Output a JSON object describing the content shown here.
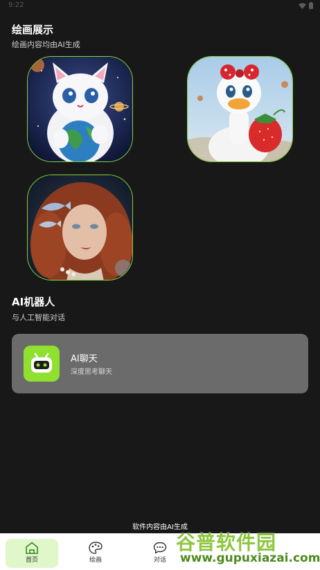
{
  "status": {
    "time": "9:22"
  },
  "gallery": {
    "title": "绘画展示",
    "subtitle": "绘画内容均由AI生成",
    "images": [
      {
        "name": "cat-holding-earth-image"
      },
      {
        "name": "duck-with-strawberry-image"
      },
      {
        "name": "redhead-woman-with-fish-image"
      }
    ]
  },
  "robot": {
    "title": "AI机器人",
    "subtitle": "与人工智能对话",
    "card": {
      "title": "AI聊天",
      "subtitle": "深度思考聊天",
      "icon": "robot-icon"
    }
  },
  "footer_note": "软件内容由AI生成",
  "tabs": [
    {
      "label": "首页",
      "icon": "home-icon",
      "active": true
    },
    {
      "label": "绘画",
      "icon": "palette-icon",
      "active": false
    },
    {
      "label": "对话",
      "icon": "chat-bubble-icon",
      "active": false
    }
  ],
  "watermark": {
    "cn": "谷普软件园",
    "url": "www.gupuxiazai.com"
  },
  "colors": {
    "accent": "#8fe02f",
    "background": "#181818",
    "card": "#6b6b6b"
  }
}
